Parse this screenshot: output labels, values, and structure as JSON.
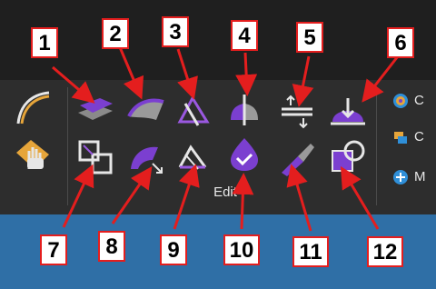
{
  "ribbon": {
    "group_label": "Edit",
    "side_items": [
      "C",
      "C",
      "M"
    ]
  },
  "callouts": [
    "1",
    "2",
    "3",
    "4",
    "5",
    "6",
    "7",
    "8",
    "9",
    "10",
    "11",
    "12"
  ],
  "colors": {
    "accent": "#7b3fd0",
    "callout_red": "#e41e1e",
    "ribbon_bg": "#2d2d2d",
    "bottom_bg": "#2f6fa6"
  }
}
